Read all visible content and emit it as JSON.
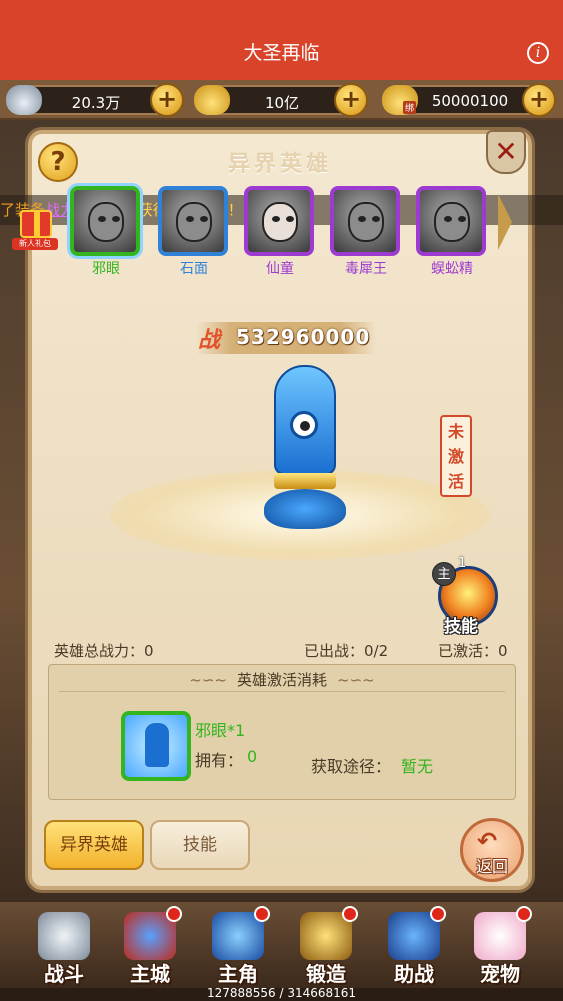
{
  "header": {
    "title": "大圣再临",
    "info_icon": "info-icon"
  },
  "resources": [
    {
      "icon": "silver-ingot-icon",
      "value": "20.3万"
    },
    {
      "icon": "gold-ingot-icon",
      "value": "10亿"
    },
    {
      "icon": "bound-gold-ingot-icon",
      "badge": "绑",
      "value": "50000100"
    }
  ],
  "panel": {
    "title": "异界英雄"
  },
  "marquee": {
    "pre": "了装备",
    "link": "战力20000",
    "text": "，获得超值好礼！"
  },
  "gift": {
    "label": "新人礼包"
  },
  "heroes": [
    {
      "name": "邪眼",
      "rarity": "green",
      "selected": true
    },
    {
      "name": "石面",
      "rarity": "blue"
    },
    {
      "name": "仙童",
      "rarity": "purple"
    },
    {
      "name": "毒犀王",
      "rarity": "purple"
    },
    {
      "name": "蜈蚣精",
      "rarity": "purple"
    }
  ],
  "power": {
    "label": "战",
    "value": "532960000"
  },
  "status": {
    "inactive": "未激活"
  },
  "skill": {
    "badge": "主",
    "level": "1",
    "label": "技能"
  },
  "stats": {
    "total_label": "英雄总战力：0",
    "deployed_label": "已出战：0/2",
    "activated_label": "已激活：0"
  },
  "cost": {
    "title": "英雄激活消耗",
    "item_name": "邪眼*1",
    "own_label": "拥有：",
    "own_value": "0",
    "source_label": "获取途径：",
    "source_value": "暂无"
  },
  "tabs": {
    "active": "异界英雄",
    "normal": "技能"
  },
  "back": {
    "label": "返回"
  },
  "nav": [
    {
      "label": "战斗",
      "icon": "swords-icon",
      "dot": false
    },
    {
      "label": "主城",
      "icon": "castle-icon",
      "dot": true
    },
    {
      "label": "主角",
      "icon": "hero-avatar-icon",
      "dot": true
    },
    {
      "label": "锻造",
      "icon": "anvil-icon",
      "dot": true
    },
    {
      "label": "助战",
      "icon": "shield-icon",
      "dot": true
    },
    {
      "label": "宠物",
      "icon": "pet-icon",
      "dot": true
    }
  ],
  "footer": {
    "exp": "127888556 / 314668161"
  }
}
